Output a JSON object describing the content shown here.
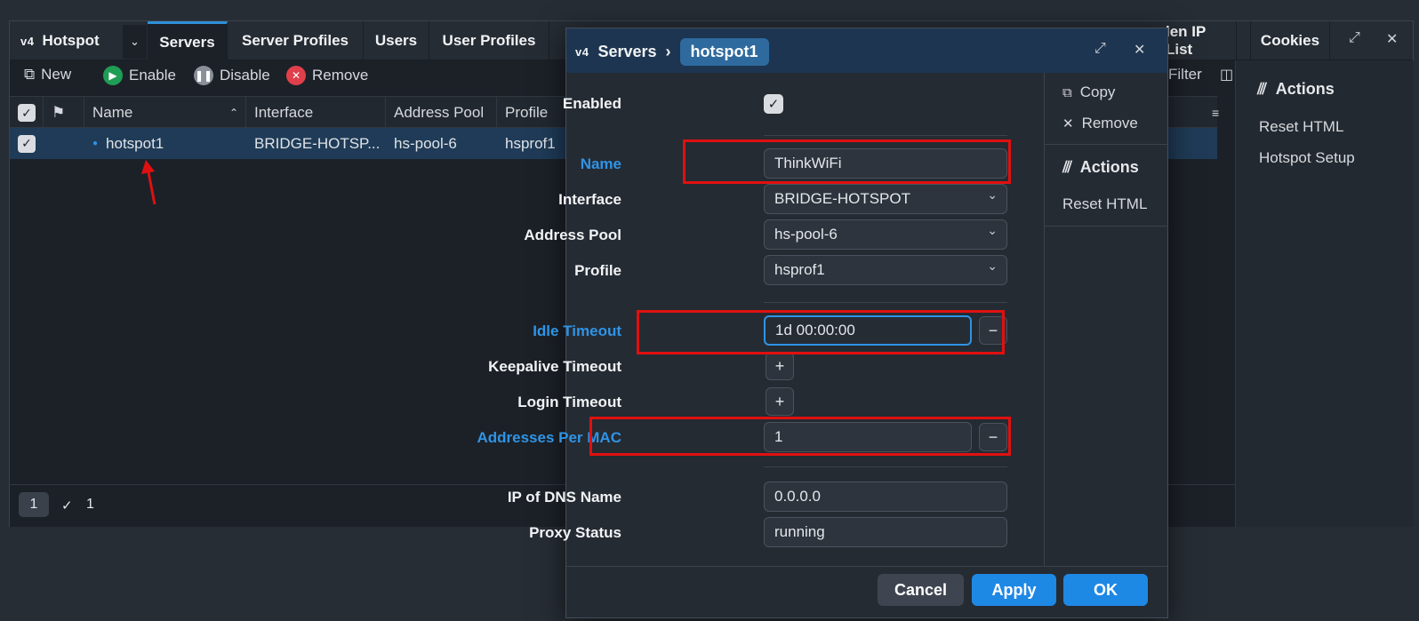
{
  "window": {
    "app_logo": "v4",
    "app_title": "Hotspot",
    "tabs": [
      "Servers",
      "Server Profiles",
      "Users",
      "User Profiles",
      "len IP List",
      "Cookies"
    ],
    "toolbar": {
      "new": "New",
      "enable": "Enable",
      "disable": "Disable",
      "remove": "Remove",
      "filter": "Filter"
    },
    "columns": [
      "Name",
      "Interface",
      "Address Pool",
      "Profile"
    ],
    "rows": [
      {
        "name": "hotspot1",
        "interface": "BRIDGE-HOTSP...",
        "address_pool": "hs-pool-6",
        "profile": "hsprof1"
      }
    ],
    "status": {
      "count": "1",
      "checked": "1"
    },
    "side": {
      "title": "Actions",
      "items": [
        "Reset HTML",
        "Hotspot Setup"
      ]
    }
  },
  "dialog": {
    "breadcrumb_root": "Servers",
    "breadcrumb_item": "hotspot1",
    "fields": {
      "enabled_label": "Enabled",
      "name_label": "Name",
      "name_value": "ThinkWiFi",
      "interface_label": "Interface",
      "interface_value": "BRIDGE-HOTSPOT",
      "address_pool_label": "Address Pool",
      "address_pool_value": "hs-pool-6",
      "profile_label": "Profile",
      "profile_value": "hsprof1",
      "idle_timeout_label": "Idle Timeout",
      "idle_timeout_value": "1d 00:00:00",
      "keepalive_label": "Keepalive Timeout",
      "login_label": "Login Timeout",
      "addr_per_mac_label": "Addresses Per MAC",
      "addr_per_mac_value": "1",
      "dns_label": "IP of DNS Name",
      "dns_value": "0.0.0.0",
      "proxy_label": "Proxy Status",
      "proxy_value": "running"
    },
    "side": {
      "copy": "Copy",
      "remove": "Remove",
      "actions": "Actions",
      "reset_html": "Reset HTML"
    },
    "buttons": {
      "cancel": "Cancel",
      "apply": "Apply",
      "ok": "OK"
    }
  },
  "colors": {
    "accent": "#2f8fd6",
    "highlight": "#e01010",
    "row_selected": "#1f3b57",
    "enable_icon": "#1f9d55",
    "remove_icon": "#e0404b"
  }
}
